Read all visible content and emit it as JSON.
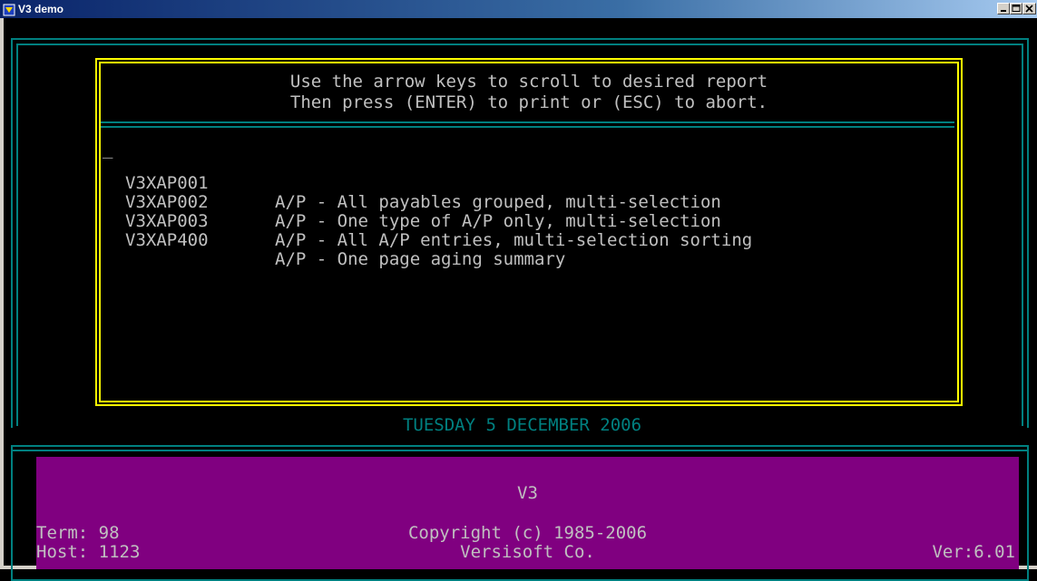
{
  "window": {
    "title": "V3 demo"
  },
  "instructions": {
    "line1": "Use the arrow keys to scroll to desired report",
    "line2": "Then press (ENTER) to print or (ESC) to abort."
  },
  "reports": [
    {
      "cursor": "_",
      "code": "V3XAP001",
      "desc": "A/P - All payables grouped, multi-selection"
    },
    {
      "cursor": "",
      "code": "V3XAP002",
      "desc": "A/P - One type of A/P only, multi-selection"
    },
    {
      "cursor": "",
      "code": "V3XAP003",
      "desc": "A/P - All A/P entries, multi-selection sorting"
    },
    {
      "cursor": "",
      "code": "V3XAP400",
      "desc": "A/P - One page aging summary"
    }
  ],
  "date": "TUESDAY 5 DECEMBER 2006",
  "banner": {
    "title": "V3",
    "term": "Term: 98",
    "host": "Host: 1123",
    "copyright_line1": "Copyright (c) 1985-2006",
    "copyright_line2": "Versisoft Co.",
    "version": "Ver:6.01"
  },
  "colors": {
    "frame": "#008080",
    "report_border": "#ffff00",
    "banner_bg": "#800080",
    "text": "#c0c0c0"
  },
  "icons": {
    "app": "terminal-app-icon",
    "minimize": "minimize-icon",
    "maximize": "maximize-icon",
    "close": "close-icon"
  }
}
